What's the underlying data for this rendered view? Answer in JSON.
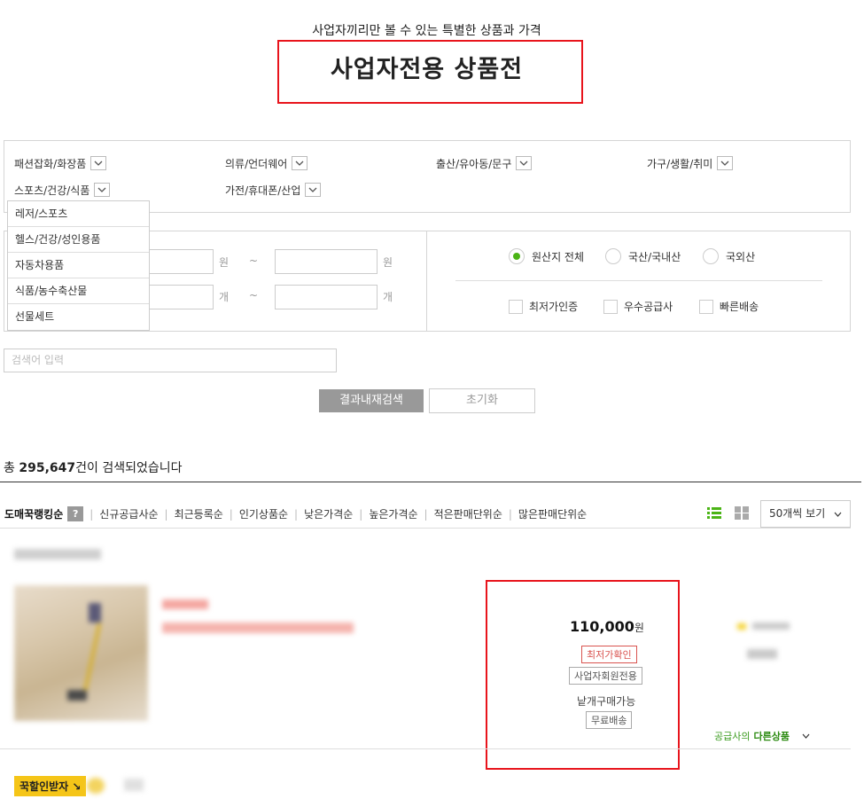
{
  "header": {
    "subtitle": "사업자끼리만 볼 수 있는 특별한 상품과 가격",
    "title": "사업자전용 상품전"
  },
  "categories": [
    {
      "label": "패션잡화/화장품"
    },
    {
      "label": "의류/언더웨어"
    },
    {
      "label": "출산/유아동/문구"
    },
    {
      "label": "가구/생활/취미"
    },
    {
      "label": "스포츠/건강/식품"
    },
    {
      "label": "가전/휴대폰/산업"
    }
  ],
  "dropdown": {
    "items": [
      "레저/스포츠",
      "헬스/건강/성인용품",
      "자동차용품",
      "식품/농수축산물",
      "선물세트"
    ]
  },
  "range": {
    "price_unit": "원",
    "qty_unit": "개",
    "tilde": "~"
  },
  "origin": {
    "options": [
      "원산지 전체",
      "국산/국내산",
      "국외산"
    ],
    "selected": 0
  },
  "flags": [
    "최저가인증",
    "우수공급사",
    "빠른배송"
  ],
  "search": {
    "placeholder": "검색어 입력",
    "search_button": "결과내재검색",
    "reset_button": "초기화"
  },
  "results": {
    "prefix": "총 ",
    "count": "295,647",
    "suffix": "건이 검색되었습니다"
  },
  "sort": {
    "options": [
      "도매꾹랭킹순",
      "신규공급사순",
      "최근등록순",
      "인기상품순",
      "낮은가격순",
      "높은가격순",
      "적은판매단위순",
      "많은판매단위순"
    ],
    "help": "?",
    "per_page": "50개씩 보기"
  },
  "product": {
    "price": "110,000",
    "price_unit": "원",
    "tags": [
      "최저가확인",
      "사업자회원전용"
    ],
    "purchase_note": "낱개구매가능",
    "shipping_tag": "무료배송",
    "supplier_link_prefix": "공급사의 ",
    "supplier_link_bold": "다른상품"
  },
  "next_badge": "꾹할인받자",
  "colors": {
    "highlight": "#e8141c",
    "radio_selected": "#4bb416",
    "list_icon": "#4bb416",
    "badge": "#f5c518"
  }
}
